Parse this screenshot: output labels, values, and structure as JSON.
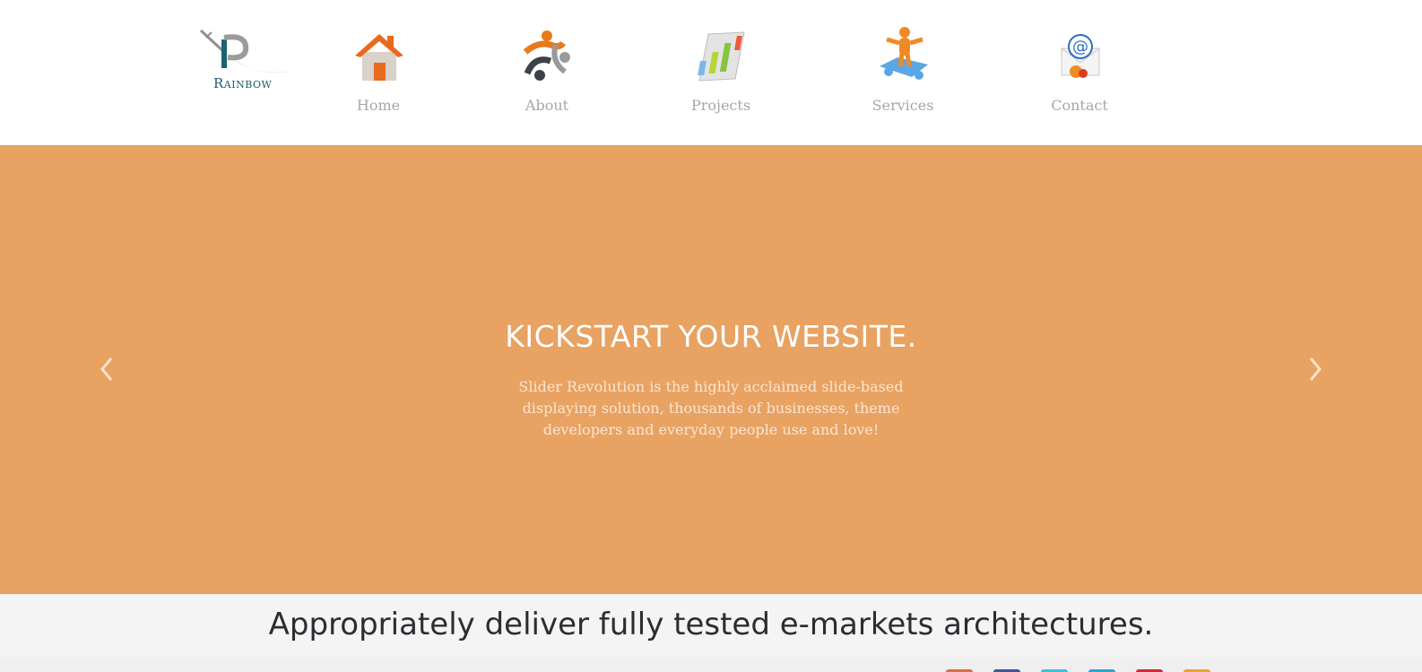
{
  "logo": {
    "text": "Rainbow"
  },
  "nav": {
    "items": [
      {
        "label": "Home",
        "icon": "house-icon"
      },
      {
        "label": "About",
        "icon": "people-icon"
      },
      {
        "label": "Projects",
        "icon": "bar-chart-icon"
      },
      {
        "label": "Services",
        "icon": "person-puzzle-icon"
      },
      {
        "label": "Contact",
        "icon": "email-icon"
      }
    ]
  },
  "slider": {
    "title": "KICKSTART YOUR WEBSITE.",
    "text": "Slider Revolution is the highly acclaimed slide-based displaying solution, thousands of businesses, theme developers and everyday people use and love!",
    "prev_icon": "chevron-left-icon",
    "next_icon": "chevron-right-icon",
    "background": "#e8a262"
  },
  "tagline": {
    "text": "Appropriately deliver fully tested e-markets architectures."
  },
  "social": {
    "icons": [
      {
        "name": "rss-icon",
        "color": "#d8733a"
      },
      {
        "name": "facebook-icon",
        "color": "#3b5998"
      },
      {
        "name": "twitter-icon",
        "color": "#3cbfe6"
      },
      {
        "name": "vimeo-icon",
        "color": "#29a6d3"
      },
      {
        "name": "pinterest-icon",
        "color": "#cc2b36"
      },
      {
        "name": "blogger-icon",
        "color": "#f0a131"
      }
    ]
  }
}
